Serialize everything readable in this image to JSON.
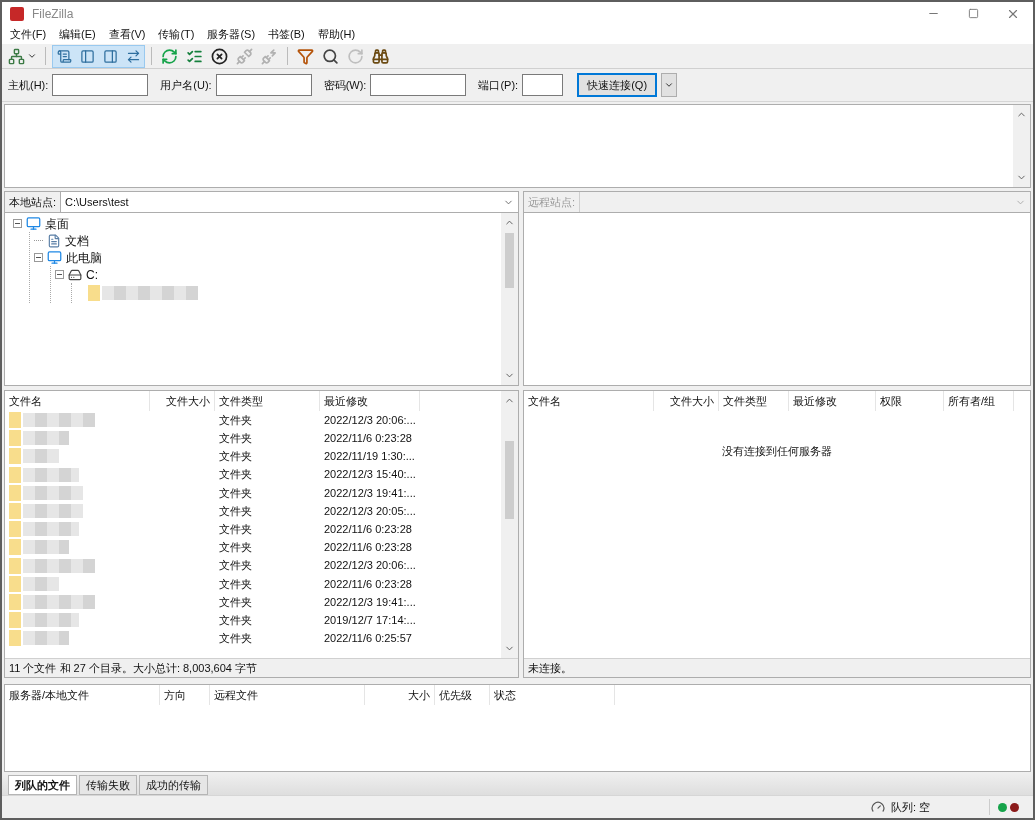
{
  "window": {
    "title": "FileZilla"
  },
  "menu": [
    "文件(F)",
    "编辑(E)",
    "查看(V)",
    "传输(T)",
    "服务器(S)",
    "书签(B)",
    "帮助(H)"
  ],
  "toolbar": {
    "toggles": [
      {
        "kind": "log",
        "selected": true
      },
      {
        "kind": "local-tree",
        "selected": true
      },
      {
        "kind": "remote-tree",
        "selected": true
      },
      {
        "kind": "queue",
        "selected": true
      }
    ],
    "actions": [
      {
        "kind": "refresh",
        "disabled": false
      },
      {
        "kind": "process",
        "disabled": false
      },
      {
        "kind": "cancel",
        "disabled": false
      },
      {
        "kind": "disconnect",
        "disabled": true
      },
      {
        "kind": "reconnect",
        "disabled": true
      },
      {
        "kind": "filter",
        "disabled": false
      },
      {
        "kind": "compare",
        "disabled": false
      },
      {
        "kind": "sync",
        "disabled": true
      },
      {
        "kind": "search",
        "disabled": false
      }
    ]
  },
  "quickconnect": {
    "fields": [
      {
        "label": "主机(H):",
        "kind": "text"
      },
      {
        "label": "用户名(U):",
        "kind": "text"
      },
      {
        "label": "密码(W):",
        "kind": "password"
      },
      {
        "label": "端口(P):",
        "kind": "port"
      }
    ],
    "button": "快速连接(Q)"
  },
  "local": {
    "label": "本地站点:",
    "path": "C:\\Users\\test",
    "tree": [
      {
        "label": "桌面",
        "kind": "desktop",
        "expanded": true,
        "children": [
          {
            "label": "文档",
            "kind": "document"
          },
          {
            "label": "此电脑",
            "kind": "computer",
            "expanded": true,
            "children": [
              {
                "label": "C:",
                "kind": "drive",
                "expanded": true
              }
            ]
          }
        ]
      }
    ],
    "columns": [
      "文件名",
      "文件大小",
      "文件类型",
      "最近修改"
    ],
    "rows": [
      {
        "type": "文件夹",
        "modified": "2022/12/3 20:06:..."
      },
      {
        "type": "文件夹",
        "modified": "2022/11/6 0:23:28"
      },
      {
        "type": "文件夹",
        "modified": "2022/11/19 1:30:..."
      },
      {
        "type": "文件夹",
        "modified": "2022/12/3 15:40:..."
      },
      {
        "type": "文件夹",
        "modified": "2022/12/3 19:41:..."
      },
      {
        "type": "文件夹",
        "modified": "2022/12/3 20:05:..."
      },
      {
        "type": "文件夹",
        "modified": "2022/11/6 0:23:28"
      },
      {
        "type": "文件夹",
        "modified": "2022/11/6 0:23:28"
      },
      {
        "type": "文件夹",
        "modified": "2022/12/3 20:06:..."
      },
      {
        "type": "文件夹",
        "modified": "2022/11/6 0:23:28"
      },
      {
        "type": "文件夹",
        "modified": "2022/12/3 19:41:..."
      },
      {
        "type": "文件夹",
        "modified": "2019/12/7 17:14:..."
      },
      {
        "type": "文件夹",
        "modified": "2022/11/6 0:25:57"
      }
    ],
    "status": "11 个文件 和 27 个目录。大小总计: 8,003,604 字节"
  },
  "remote": {
    "label": "远程站点:",
    "columns": [
      "文件名",
      "文件大小",
      "文件类型",
      "最近修改",
      "权限",
      "所有者/组"
    ],
    "message": "没有连接到任何服务器",
    "status": "未连接。"
  },
  "queue": {
    "columns": [
      "服务器/本地文件",
      "方向",
      "远程文件",
      "大小",
      "优先级",
      "状态"
    ],
    "tabs": [
      {
        "label": "列队的文件",
        "selected": true
      },
      {
        "label": "传输失败",
        "selected": false
      },
      {
        "label": "成功的传输",
        "selected": false
      }
    ]
  },
  "status_bar": {
    "queue": "队列: 空"
  }
}
